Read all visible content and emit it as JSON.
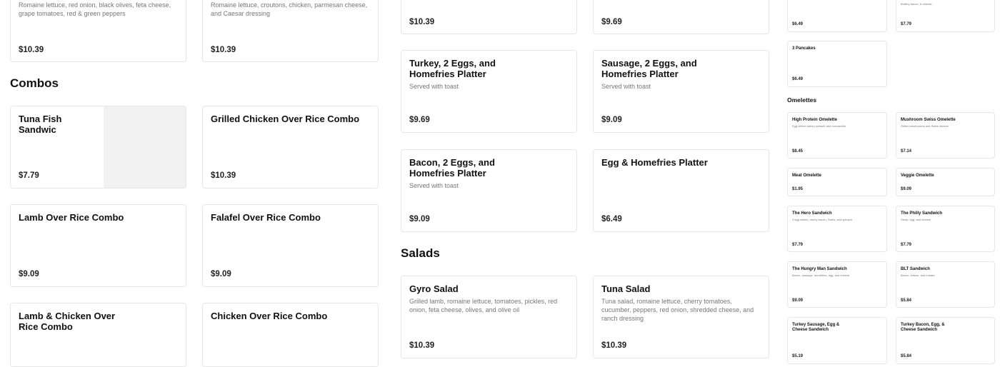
{
  "col1": {
    "top_cards": [
      {
        "description": "Romaine lettuce, red onion, black olives, feta cheese, grape tomatoes, red & green peppers",
        "price": "$10.39"
      },
      {
        "description": "Romaine lettuce, croutons, chicken, parmesan cheese, and Caesar dressing",
        "price": "$10.39"
      }
    ],
    "combos_heading": "Combos",
    "combos": [
      {
        "title": "Tuna Fish Sandwic",
        "price": "$7.79"
      },
      {
        "title": "Grilled Chicken Over Rice Combo",
        "price": "$10.39"
      },
      {
        "title": "Lamb Over Rice Combo",
        "price": "$9.09"
      },
      {
        "title": "Falafel Over Rice Combo",
        "price": "$9.09"
      },
      {
        "title": "Lamb & Chicken Over Rice Combo",
        "price": ""
      },
      {
        "title": "Chicken Over Rice Combo",
        "price": ""
      }
    ]
  },
  "col2": {
    "top_prices": [
      "$10.39",
      "$9.69"
    ],
    "platters": [
      {
        "title": "Turkey, 2 Eggs, and Homefries Platter",
        "description": "Served with toast",
        "price": "$9.69"
      },
      {
        "title": "Sausage, 2 Eggs, and Homefries Platter",
        "description": "Served with toast",
        "price": "$9.09"
      },
      {
        "title": "Bacon, 2 Eggs, and Homefries Platter",
        "description": "Served with toast",
        "price": "$9.09"
      },
      {
        "title": "Egg & Homefries Platter",
        "description": "",
        "price": "$6.49"
      }
    ],
    "salads_heading": "Salads",
    "salads": [
      {
        "title": "Gyro Salad",
        "description": "Grilled lamb, romaine lettuce, tomatoes, pickles, red onion, feta cheese, olives, and olive oil",
        "price": "$10.39"
      },
      {
        "title": "Tuna Salad",
        "description": "Tuna salad, romaine lettuce, cherry tomatoes, cucumber, peppers, red onion, shredded cheese, and ranch dressing",
        "price": "$10.39"
      }
    ]
  },
  "col3": {
    "top_cards": [
      {
        "title": "",
        "description": "",
        "price": "$6.49"
      },
      {
        "title": "",
        "description": "Buttery bacon, & cheese",
        "price": "$7.79"
      },
      {
        "title": "3 Pancakes",
        "description": "",
        "price": "$6.49"
      }
    ],
    "omelettes_heading": "Omelettes",
    "items": [
      {
        "title": "High Protein Omelette",
        "description": "Egg whites turkey spinach and mozzarella",
        "price": "$8.45"
      },
      {
        "title": "Mushroom Swiss Omelette",
        "description": "Grilled mushrooms and Swiss cheese",
        "price": "$7.14"
      },
      {
        "title": "Meat Omelette",
        "description": "",
        "price": "$1.95"
      },
      {
        "title": "Veggie Omelette",
        "description": "",
        "price": "$9.09"
      },
      {
        "title": "The Hero Sandwich",
        "description": "3 egg whites, turkey bacon, Swiss, and spinach",
        "price": "$7.79"
      },
      {
        "title": "The Philly Sandwich",
        "description": "Steak, egg, and cheese",
        "price": "$7.79"
      },
      {
        "title": "The Hungry Man Sandwich",
        "description": "Bacon, sausage, homefries, egg, and cheese",
        "price": "$9.09"
      },
      {
        "title": "BLT Sandwich",
        "description": "Bacon, lettuce, and tomato",
        "price": "$5.84"
      },
      {
        "title": "Turkey Sausage, Egg & Cheese Sandwich",
        "description": "",
        "price": "$5.19"
      },
      {
        "title": "Turkey Bacon, Egg, & Cheese Sandwich",
        "description": "",
        "price": "$5.84"
      }
    ]
  }
}
